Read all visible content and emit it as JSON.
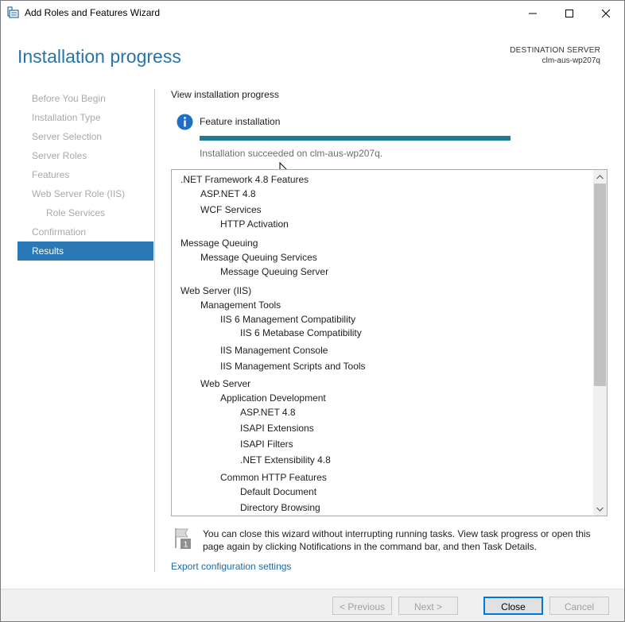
{
  "window": {
    "title": "Add Roles and Features Wizard",
    "icons": {
      "app": "server-manager-icon",
      "minimize": "minimize-icon",
      "maximize": "maximize-icon",
      "close": "close-icon"
    }
  },
  "header": {
    "page_title": "Installation progress",
    "destination_label": "DESTINATION SERVER",
    "destination_server": "clm-aus-wp207q"
  },
  "nav": {
    "items": [
      {
        "label": "Before You Begin"
      },
      {
        "label": "Installation Type"
      },
      {
        "label": "Server Selection"
      },
      {
        "label": "Server Roles"
      },
      {
        "label": "Features"
      },
      {
        "label": "Web Server Role (IIS)"
      },
      {
        "label": "Role Services"
      },
      {
        "label": "Confirmation"
      },
      {
        "label": "Results"
      }
    ],
    "active": "Results"
  },
  "main": {
    "heading": "View installation progress",
    "status_title": "Feature installation",
    "progress_percent": 100,
    "progress_color": "#1d7b92",
    "status_message": "Installation succeeded on clm-aus-wp207q.",
    "features": [
      {
        "label": ".NET Framework 4.8 Features"
      },
      {
        "label": "ASP.NET 4.8"
      },
      {
        "label": "WCF Services"
      },
      {
        "label": "HTTP Activation"
      },
      {
        "label": "Message Queuing"
      },
      {
        "label": "Message Queuing Services"
      },
      {
        "label": "Message Queuing Server"
      },
      {
        "label": "Web Server (IIS)"
      },
      {
        "label": "Management Tools"
      },
      {
        "label": "IIS 6 Management Compatibility"
      },
      {
        "label": "IIS 6 Metabase Compatibility"
      },
      {
        "label": "IIS Management Console"
      },
      {
        "label": "IIS Management Scripts and Tools"
      },
      {
        "label": "Web Server"
      },
      {
        "label": "Application Development"
      },
      {
        "label": "ASP.NET 4.8"
      },
      {
        "label": "ISAPI Extensions"
      },
      {
        "label": "ISAPI Filters"
      },
      {
        "label": ".NET Extensibility 4.8"
      },
      {
        "label": "Common HTTP Features"
      },
      {
        "label": "Default Document"
      },
      {
        "label": "Directory Browsing"
      }
    ],
    "note": "You can close this wizard without interrupting running tasks. View task progress or open this page again by clicking Notifications in the command bar, and then Task Details.",
    "export_link": "Export configuration settings"
  },
  "footer": {
    "previous": "< Previous",
    "next": "Next >",
    "close": "Close",
    "cancel": "Cancel"
  }
}
